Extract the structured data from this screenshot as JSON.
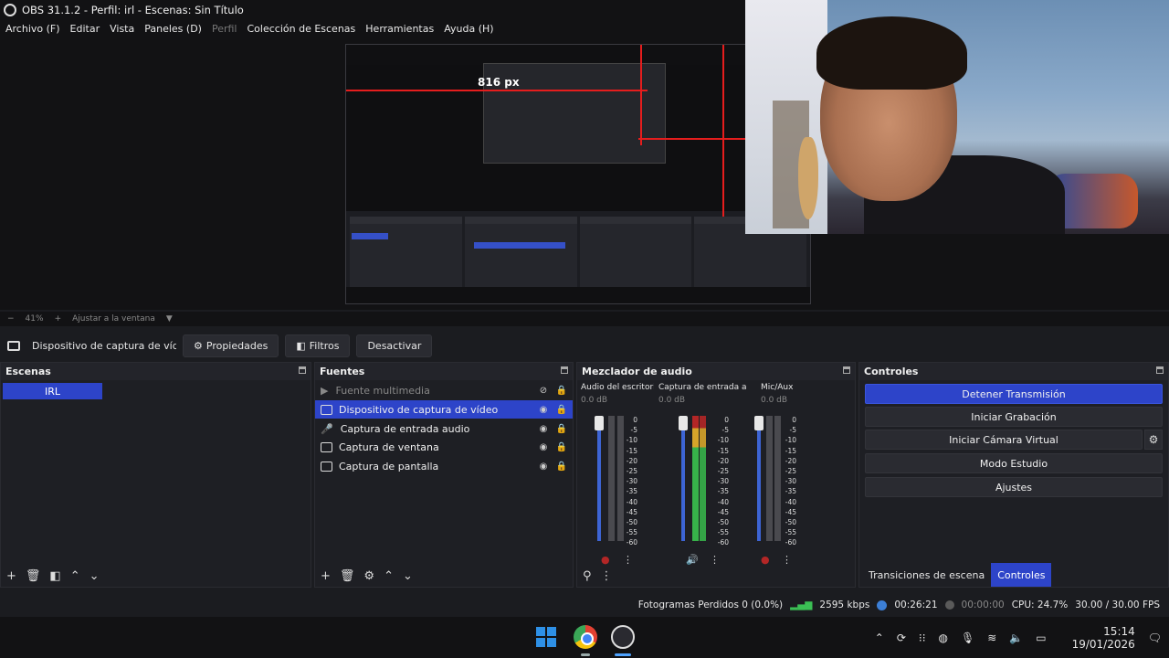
{
  "window": {
    "title": "OBS 31.1.2 - Perfil: irl - Escenas: Sin Título"
  },
  "menu": {
    "items": [
      "Archivo (F)",
      "Editar",
      "Vista",
      "Paneles (D)",
      "Perfil",
      "Colección de Escenas",
      "Herramientas",
      "Ayuda (H)"
    ]
  },
  "preview": {
    "nested_label": "816 px",
    "zoom_minus": "−",
    "zoom_value": "41%",
    "zoom_plus": "+",
    "fit_label": "Ajustar a la ventana"
  },
  "context_bar": {
    "source_name": "Dispositivo de captura de vídeo",
    "properties_label": "Propiedades",
    "filters_label": "Filtros",
    "deactivate_label": "Desactivar"
  },
  "scenes": {
    "title": "Escenas",
    "items": [
      "IRL"
    ]
  },
  "sources": {
    "title": "Fuentes",
    "items": [
      {
        "label": "Fuente multimedia",
        "visible": false
      },
      {
        "label": "Dispositivo de captura de vídeo",
        "visible": true
      },
      {
        "label": "Captura de entrada audio",
        "visible": true
      },
      {
        "label": "Captura de ventana",
        "visible": true
      },
      {
        "label": "Captura de pantalla",
        "visible": true
      }
    ]
  },
  "mixer": {
    "title": "Mezclador de audio",
    "channels": [
      {
        "name": "Audio del escritorio",
        "db": "0.0 dB"
      },
      {
        "name": "Captura de entrada aud",
        "db": "0.0 dB"
      },
      {
        "name": "Mic/Aux",
        "db": "0.0 dB"
      }
    ],
    "scale": [
      "0",
      "-5",
      "-10",
      "-15",
      "-20",
      "-25",
      "-30",
      "-35",
      "-40",
      "-45",
      "-50",
      "-55",
      "-60"
    ]
  },
  "controls": {
    "title": "Controles",
    "stop_stream": "Detener Transmisión",
    "start_record": "Iniciar Grabación",
    "start_vcam": "Iniciar Cámara Virtual",
    "studio_mode": "Modo Estudio",
    "settings": "Ajustes",
    "tab_transitions": "Transiciones de escena",
    "tab_controls": "Controles"
  },
  "status": {
    "dropped": "Fotogramas Perdidos 0 (0.0%)",
    "bitrate": "2595 kbps",
    "stream_time": "00:26:21",
    "rec_time": "00:00:00",
    "cpu": "CPU: 24.7%",
    "fps": "30.00 / 30.00 FPS"
  },
  "taskbar": {
    "time": "15:14",
    "date": "19/01/2026"
  },
  "colors": {
    "accent": "#2d44c9",
    "meter_green": "#37b24a",
    "meter_yellow": "#d6a42a",
    "meter_red": "#b32626"
  }
}
